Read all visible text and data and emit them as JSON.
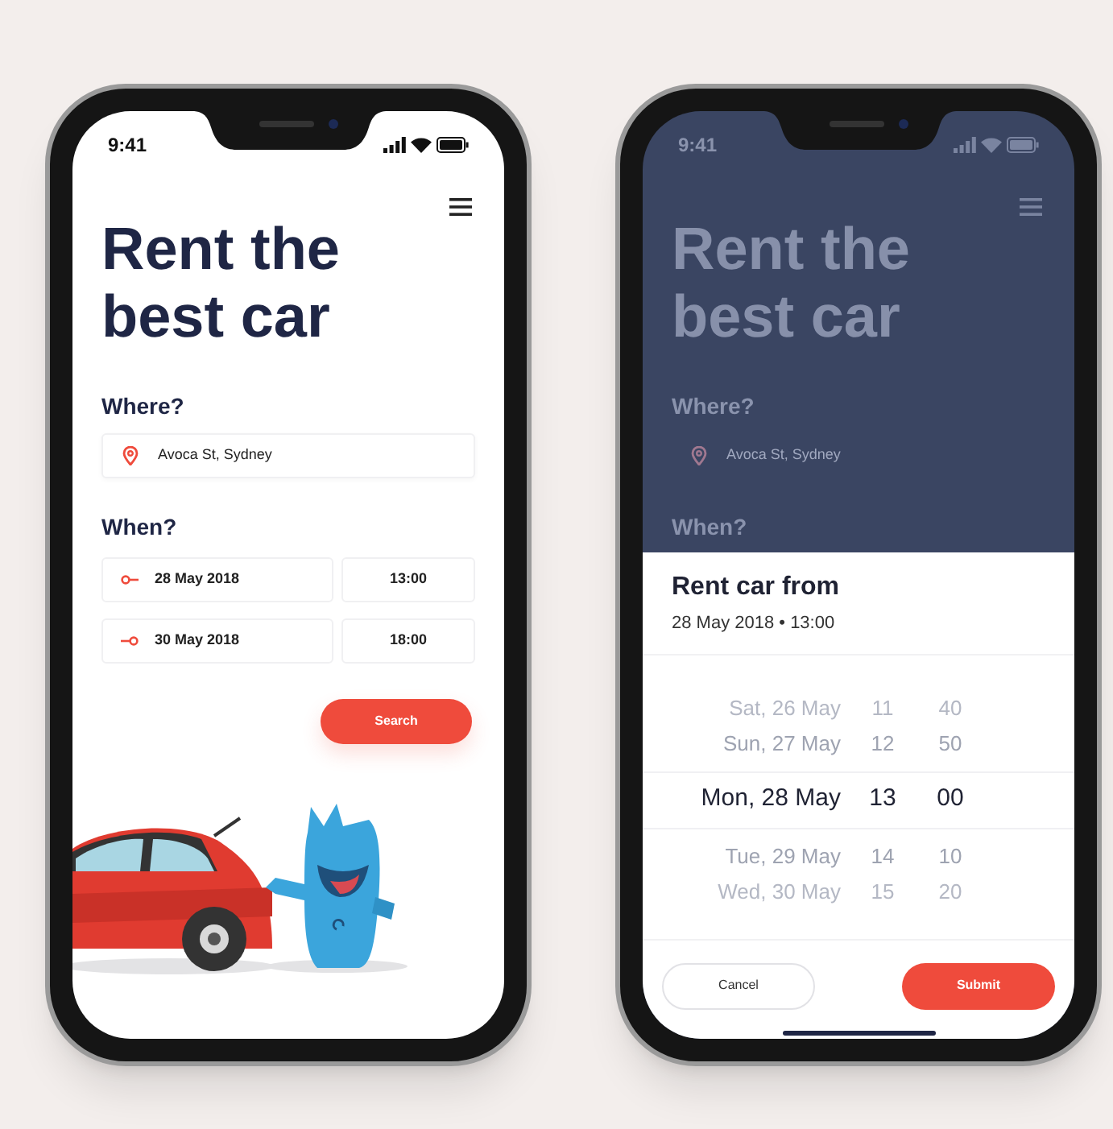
{
  "screen_1": {
    "status_bar": {
      "time": "9:41"
    },
    "title": "Rent the best car",
    "where_label": "Where?",
    "location": "Avoca St, Sydney",
    "when_label": "When?",
    "dates": [
      {
        "kind": "pickup",
        "date": "28 May 2018",
        "time": "13:00"
      },
      {
        "kind": "return",
        "date": "30 May 2018",
        "time": "18:00"
      }
    ],
    "search_button": "Search"
  },
  "screen_2": {
    "status_bar": {
      "time": "9:41"
    },
    "title": "Rent the best car",
    "where_label": "Where?",
    "location": "Avoca St, Sydney",
    "when_label": "When?",
    "sheet": {
      "title": "Rent car from",
      "subtitle": "28 May 2018 • 13:00",
      "picker_rows": [
        {
          "day": "Sat, 26 May",
          "hour": "11",
          "minute": "40",
          "selected": false
        },
        {
          "day": "Sun, 27 May",
          "hour": "12",
          "minute": "50",
          "selected": false
        },
        {
          "day": "Mon, 28 May",
          "hour": "13",
          "minute": "00",
          "selected": true
        },
        {
          "day": "Tue, 29 May",
          "hour": "14",
          "minute": "10",
          "selected": false
        },
        {
          "day": "Wed, 30 May",
          "hour": "15",
          "minute": "20",
          "selected": false
        }
      ],
      "cancel_button": "Cancel",
      "submit_button": "Submit"
    }
  }
}
